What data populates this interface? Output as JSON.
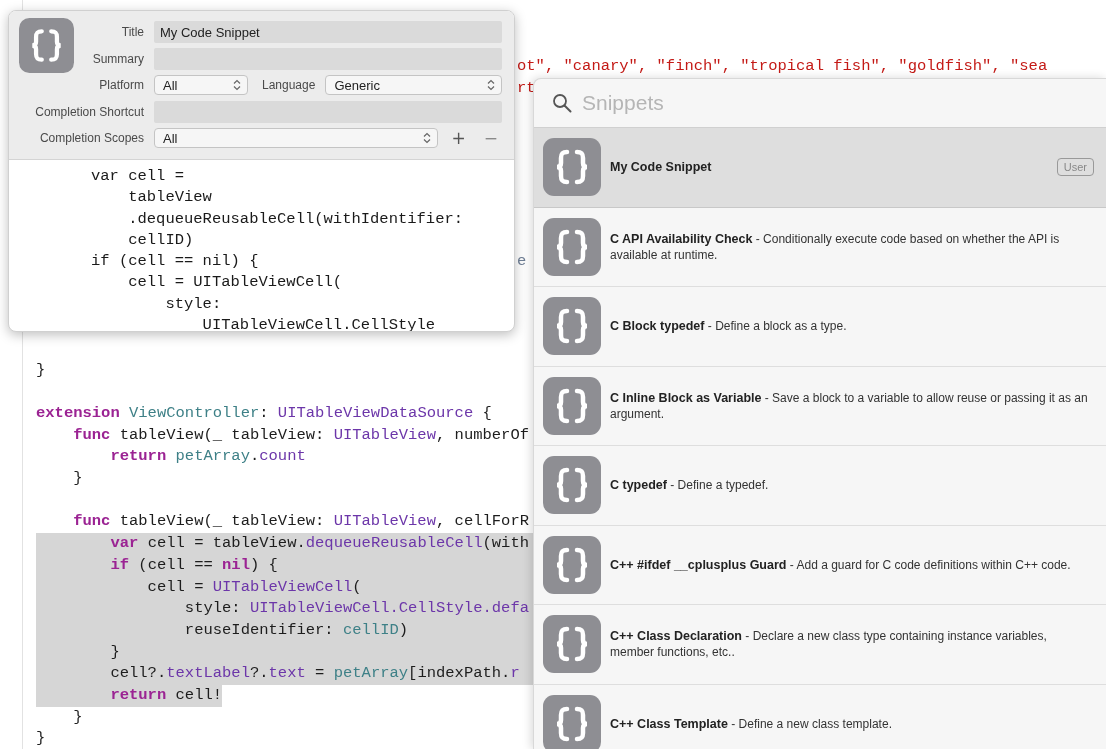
{
  "editor": {
    "lines": [
      {
        "kind": "fragment",
        "selected": false,
        "tokens": [
          {
            "kind": "string",
            "text": "ot\", \"canary\", \"finch\", \"tropical fish\", \"goldfish\", \"sea"
          }
        ]
      },
      {
        "kind": "fragment",
        "selected": false,
        "tokens": [
          {
            "kind": "string",
            "text": "rt"
          }
        ]
      },
      {
        "kind": "blank"
      },
      {
        "kind": "blank"
      },
      {
        "kind": "blank"
      },
      {
        "kind": "blank"
      },
      {
        "kind": "blank"
      },
      {
        "kind": "blank"
      },
      {
        "kind": "blank"
      },
      {
        "kind": "fragment",
        "selected": false,
        "tokens": [
          {
            "kind": "other",
            "text": "e"
          }
        ]
      },
      {
        "kind": "blank"
      },
      {
        "kind": "blank"
      },
      {
        "kind": "blank"
      },
      {
        "kind": "blank"
      },
      {
        "kind": "code",
        "selected": false,
        "tokens": [
          {
            "kind": "plain",
            "text": "}"
          }
        ]
      },
      {
        "kind": "blank"
      },
      {
        "kind": "code",
        "selected": false,
        "tokens": [
          {
            "kind": "keyword",
            "text": "extension "
          },
          {
            "kind": "project",
            "text": "ViewController"
          },
          {
            "kind": "plain",
            "text": ": "
          },
          {
            "kind": "system",
            "text": "UITableViewDataSource"
          },
          {
            "kind": "plain",
            "text": " {"
          }
        ]
      },
      {
        "kind": "code",
        "selected": false,
        "tokens": [
          {
            "kind": "keyword",
            "text": "    func "
          },
          {
            "kind": "plain",
            "text": "tableView(_ tableView: "
          },
          {
            "kind": "system",
            "text": "UITableView"
          },
          {
            "kind": "plain",
            "text": ", numberOf"
          }
        ]
      },
      {
        "kind": "code",
        "selected": false,
        "tokens": [
          {
            "kind": "keyword",
            "text": "        return "
          },
          {
            "kind": "project",
            "text": "petArray"
          },
          {
            "kind": "plain",
            "text": "."
          },
          {
            "kind": "system",
            "text": "count"
          }
        ]
      },
      {
        "kind": "code",
        "selected": false,
        "tokens": [
          {
            "kind": "plain",
            "text": "    }"
          }
        ]
      },
      {
        "kind": "blank"
      },
      {
        "kind": "code",
        "selected": false,
        "tokens": [
          {
            "kind": "keyword",
            "text": "    func "
          },
          {
            "kind": "plain",
            "text": "tableView(_ tableView: "
          },
          {
            "kind": "system",
            "text": "UITableView"
          },
          {
            "kind": "plain",
            "text": ", cellForR"
          }
        ]
      },
      {
        "kind": "code",
        "selected": true,
        "tokens": [
          {
            "kind": "keyword",
            "text": "        var "
          },
          {
            "kind": "plain",
            "text": "cell = tableView."
          },
          {
            "kind": "system",
            "text": "dequeueReusableCell"
          },
          {
            "kind": "plain",
            "text": "(with"
          }
        ]
      },
      {
        "kind": "code",
        "selected": true,
        "tokens": [
          {
            "kind": "keyword",
            "text": "        if "
          },
          {
            "kind": "plain",
            "text": "(cell == "
          },
          {
            "kind": "keyword",
            "text": "nil"
          },
          {
            "kind": "plain",
            "text": ") {"
          }
        ]
      },
      {
        "kind": "code",
        "selected": true,
        "tokens": [
          {
            "kind": "plain",
            "text": "            cell = "
          },
          {
            "kind": "system",
            "text": "UITableViewCell"
          },
          {
            "kind": "plain",
            "text": "("
          }
        ]
      },
      {
        "kind": "code",
        "selected": true,
        "tokens": [
          {
            "kind": "plain",
            "text": "                style: "
          },
          {
            "kind": "system",
            "text": "UITableViewCell.CellStyle.defa"
          }
        ]
      },
      {
        "kind": "code",
        "selected": true,
        "tokens": [
          {
            "kind": "plain",
            "text": "                reuseIdentifier: "
          },
          {
            "kind": "project",
            "text": "cellID"
          },
          {
            "kind": "plain",
            "text": ")"
          }
        ]
      },
      {
        "kind": "code",
        "selected": true,
        "tokens": [
          {
            "kind": "plain",
            "text": "        }"
          }
        ]
      },
      {
        "kind": "code",
        "selected": true,
        "tokens": [
          {
            "kind": "plain",
            "text": "        cell?."
          },
          {
            "kind": "system",
            "text": "textLabel"
          },
          {
            "kind": "plain",
            "text": "?."
          },
          {
            "kind": "system",
            "text": "text"
          },
          {
            "kind": "plain",
            "text": " = "
          },
          {
            "kind": "project",
            "text": "petArray"
          },
          {
            "kind": "plain",
            "text": "[indexPath."
          },
          {
            "kind": "system",
            "text": "r"
          }
        ]
      },
      {
        "kind": "code",
        "selected": true,
        "partial": true,
        "tokens": [
          {
            "kind": "keyword",
            "text": "        return "
          },
          {
            "kind": "plain",
            "text": "cell!"
          }
        ]
      },
      {
        "kind": "code",
        "selected": false,
        "tokens": [
          {
            "kind": "plain",
            "text": "    }"
          }
        ]
      },
      {
        "kind": "code",
        "selected": false,
        "tokens": [
          {
            "kind": "plain",
            "text": "}"
          }
        ]
      }
    ]
  },
  "snippet_editor": {
    "rows": [
      {
        "fields": [
          {
            "label": "Title",
            "kind": "text",
            "value": "My Code Snippet"
          }
        ]
      },
      {
        "fields": [
          {
            "label": "Summary",
            "kind": "text"
          }
        ]
      },
      {
        "fields": [
          {
            "label": "Platform",
            "kind": "select",
            "value": "All"
          },
          {
            "label": "Language",
            "kind": "select",
            "value": "Generic"
          }
        ]
      },
      {
        "fields": [
          {
            "label": "Completion Shortcut",
            "kind": "text"
          }
        ]
      },
      {
        "fields": [
          {
            "label": "Completion Scopes",
            "kind": "select",
            "value": "All"
          }
        ],
        "buttons": [
          {
            "text": "+",
            "disabled": false
          },
          {
            "text": "−",
            "disabled": true
          }
        ]
      }
    ],
    "code": [
      "var cell =",
      "    tableView",
      "    .dequeueReusableCell(withIdentifier:",
      "    cellID)",
      "if (cell == nil) {",
      "    cell = UITableViewCell(",
      "        style:",
      "            UITableViewCell.CellStyle"
    ]
  },
  "library": {
    "search": {
      "placeholder": "Snippets"
    },
    "items": [
      {
        "title": "My Code Snippet",
        "selected": true,
        "badge": "User"
      },
      {
        "title": "C API Availability Check",
        "description": "- Conditionally execute code based on whether the API is available at runtime.",
        "selected": false
      },
      {
        "title": "C Block typedef",
        "description": "- Define a block as a type.",
        "selected": false
      },
      {
        "title": "C Inline Block as Variable",
        "description": "- Save a block to a variable to allow reuse or passing it as an argument.",
        "selected": false
      },
      {
        "title": "C typedef",
        "description": "- Define a typedef.",
        "selected": false
      },
      {
        "title": "C++ #ifdef __cplusplus Guard",
        "description": "- Add a guard for C code definitions within C++ code.",
        "selected": false
      },
      {
        "title": "C++ Class Declaration",
        "description": "- Declare a new class type containing instance variables, member functions, etc..",
        "selected": false
      },
      {
        "title": "C++ Class Template",
        "description": "- Define a new class template.",
        "selected": false
      }
    ]
  }
}
